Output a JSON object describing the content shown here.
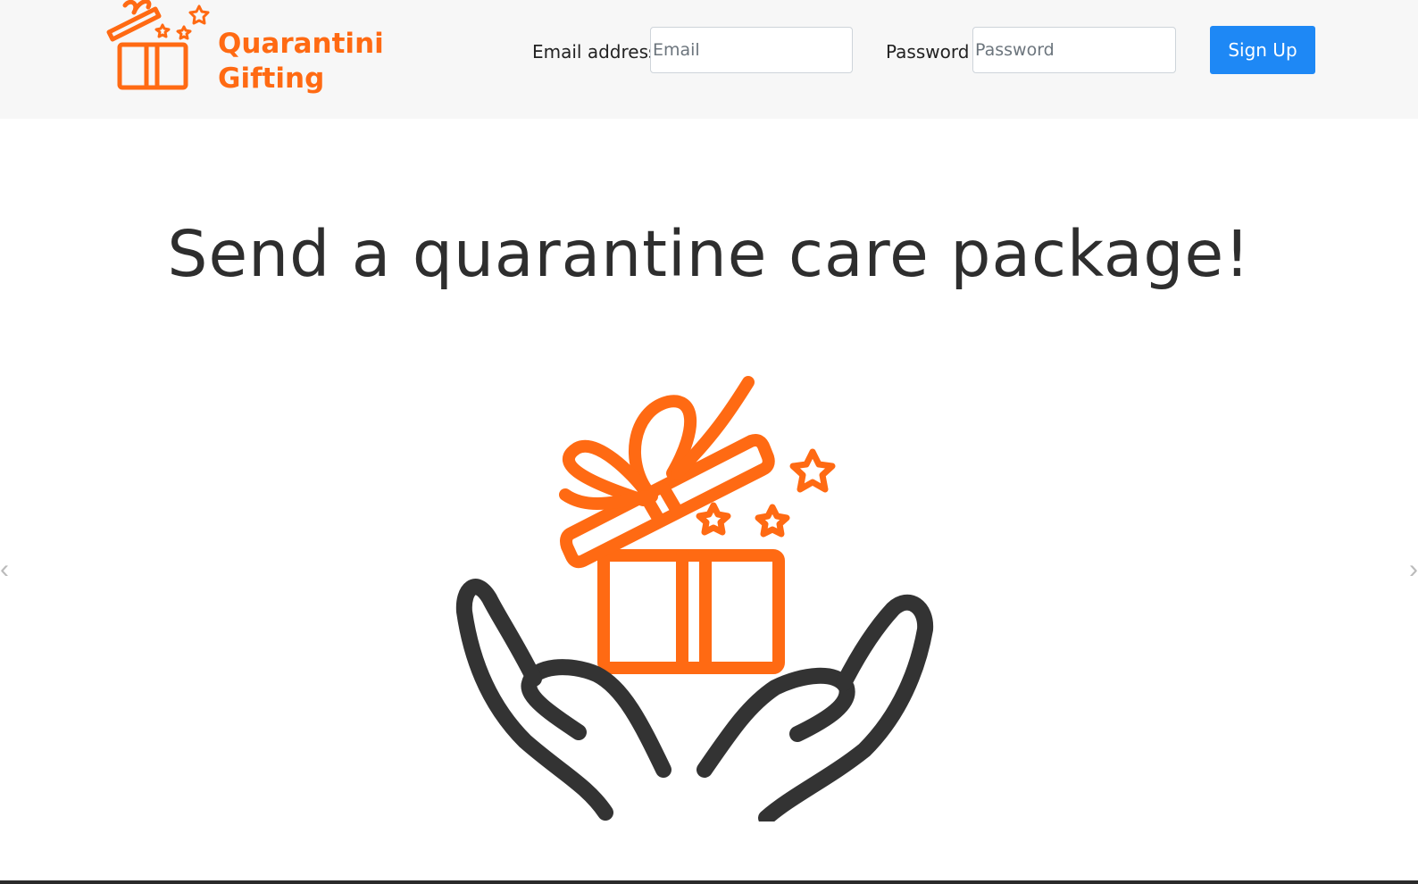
{
  "brand": {
    "line1": "Quarantini",
    "line2": "Gifting",
    "color": "#ff6a13",
    "logo_icon": "gift-box-icon"
  },
  "signup_form": {
    "email_label": "Email address",
    "email_placeholder": "Email",
    "email_value": "",
    "password_label": "Password",
    "password_placeholder": "Password",
    "password_value": "",
    "submit_label": "Sign Up",
    "submit_color": "#1e88f5"
  },
  "hero": {
    "title": "Send a quarantine care package!",
    "image_icon": "hands-holding-gift-icon"
  },
  "carousel": {
    "prev_icon": "chevron-left-icon",
    "next_icon": "chevron-right-icon",
    "prev_glyph": "‹",
    "next_glyph": "›"
  }
}
